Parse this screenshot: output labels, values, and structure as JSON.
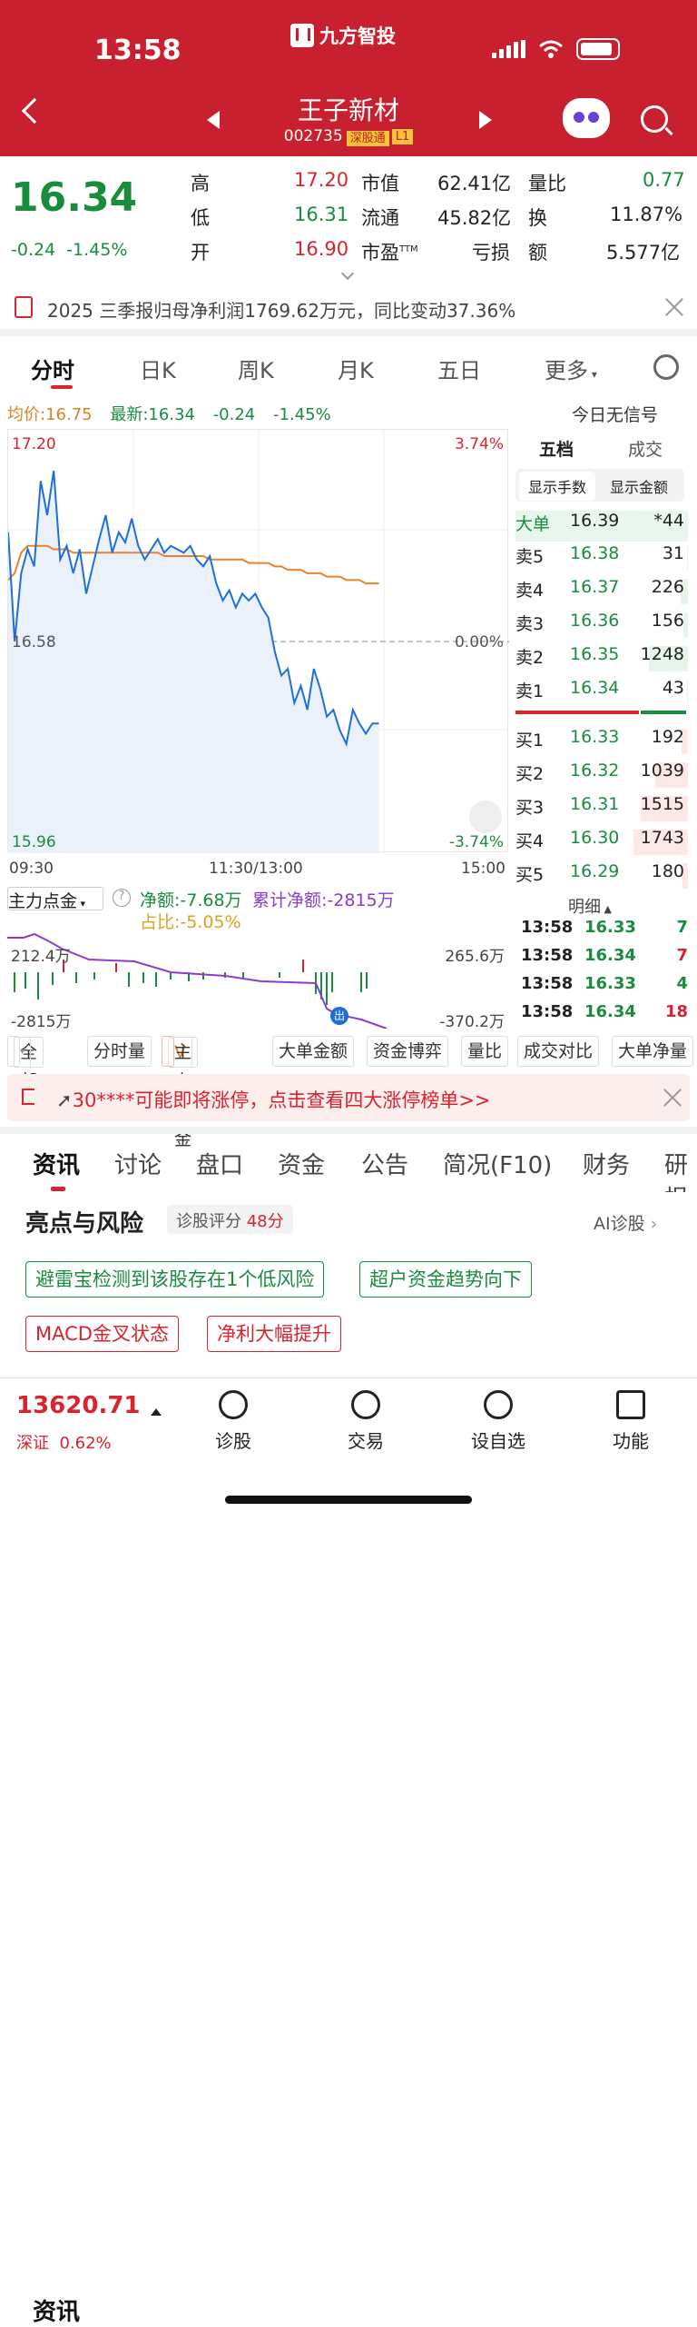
{
  "status": {
    "time": "13:58",
    "app_name": "九方智投"
  },
  "stock": {
    "name": "王子新材",
    "code": "002735",
    "tag1": "深股通",
    "tag2": "L1"
  },
  "quote": {
    "price": "16.34",
    "change": "-0.24",
    "change_pct": "-1.45%",
    "high_label": "高",
    "high": "17.20",
    "low_label": "低",
    "low": "16.31",
    "open_label": "开",
    "open": "16.90",
    "mcap_label": "市值",
    "mcap": "62.41亿",
    "float_label": "流通",
    "float": "45.82亿",
    "pe_label": "市盈",
    "pe_sup": "TTM",
    "pe": "亏损",
    "vr_label": "量比",
    "vr": "0.77",
    "turn_label": "换",
    "turn": "11.87%",
    "amt_label": "额",
    "amt": "5.577亿"
  },
  "notice": "2025 三季报归母净利润1769.62万元，同比变动37.36%",
  "chart_tabs": [
    "分时",
    "日K",
    "周K",
    "月K",
    "五日",
    "更多"
  ],
  "avg_line": {
    "avg": "均价:16.75",
    "latest": "最新:16.34",
    "chg": "-0.24",
    "pct": "-1.45%"
  },
  "no_signal": "今日无信号",
  "chart_data": {
    "type": "line",
    "x_ticks": [
      "09:30",
      "11:30/13:00",
      "15:00"
    ],
    "y_left": [
      "17.20",
      "16.58",
      "15.96"
    ],
    "y_right": [
      "3.74%",
      "0.00%",
      "-3.74%"
    ],
    "prev_close": 16.58,
    "ylim": [
      15.96,
      17.2
    ],
    "series": [
      {
        "values": [
          16.9,
          16.58,
          16.78,
          16.85,
          16.8,
          17.05,
          16.95,
          17.08,
          16.82,
          16.86,
          16.78,
          16.85,
          16.72,
          16.8,
          16.88,
          16.95,
          16.84,
          16.9,
          16.87,
          16.94,
          16.86,
          16.82,
          16.85,
          16.88,
          16.84,
          16.86,
          16.85,
          16.84,
          16.86,
          16.82,
          16.8,
          16.83,
          16.75,
          16.7,
          16.73,
          16.68,
          16.72,
          16.7,
          16.72,
          16.68,
          16.65,
          16.55,
          16.48,
          16.5,
          16.4,
          16.45,
          16.38,
          16.5,
          16.44,
          16.36,
          16.38,
          16.32,
          16.28,
          16.38,
          16.34,
          16.31,
          16.34,
          16.34
        ]
      },
      {
        "values": [
          16.76,
          16.78,
          16.84,
          16.86,
          16.86,
          16.86,
          16.86,
          16.85,
          16.85,
          16.85,
          16.84,
          16.84,
          16.84,
          16.84,
          16.84,
          16.84,
          16.84,
          16.84,
          16.84,
          16.84,
          16.84,
          16.84,
          16.84,
          16.84,
          16.83,
          16.83,
          16.83,
          16.83,
          16.83,
          16.83,
          16.83,
          16.82,
          16.82,
          16.82,
          16.82,
          16.82,
          16.82,
          16.81,
          16.81,
          16.81,
          16.81,
          16.8,
          16.8,
          16.79,
          16.79,
          16.79,
          16.78,
          16.78,
          16.78,
          16.77,
          16.77,
          16.77,
          16.76,
          16.76,
          16.76,
          16.75,
          16.75,
          16.75
        ]
      }
    ]
  },
  "orderbook": {
    "tabs": [
      "五档",
      "成交"
    ],
    "buttons": [
      "显示手数",
      "显示金额"
    ],
    "big": {
      "label": "大单",
      "price": "16.39",
      "vol": "*44"
    },
    "asks": [
      {
        "label": "卖5",
        "price": "16.38",
        "vol": "31"
      },
      {
        "label": "卖4",
        "price": "16.37",
        "vol": "226"
      },
      {
        "label": "卖3",
        "price": "16.36",
        "vol": "156"
      },
      {
        "label": "卖2",
        "price": "16.35",
        "vol": "1248"
      },
      {
        "label": "卖1",
        "price": "16.34",
        "vol": "43"
      }
    ],
    "bids": [
      {
        "label": "买1",
        "price": "16.33",
        "vol": "192"
      },
      {
        "label": "买2",
        "price": "16.32",
        "vol": "1039"
      },
      {
        "label": "买3",
        "price": "16.31",
        "vol": "1515"
      },
      {
        "label": "买4",
        "price": "16.30",
        "vol": "1743"
      },
      {
        "label": "买5",
        "price": "16.29",
        "vol": "180"
      }
    ],
    "detail_label": "明细",
    "trades": [
      {
        "t": "13:58",
        "p": "16.33",
        "v": "7"
      },
      {
        "t": "13:58",
        "p": "16.34",
        "v": "7"
      },
      {
        "t": "13:58",
        "p": "16.33",
        "v": "4"
      },
      {
        "t": "13:58",
        "p": "16.34",
        "v": "18"
      }
    ]
  },
  "flow": {
    "select": "主力点金",
    "net": "净额:-7.68万",
    "cum": "累计净额:-2815万",
    "ratio": "占比:-5.05%",
    "y1": "212.4万",
    "y2": "-2815万",
    "y3": "265.6万",
    "y4": "-370.2万",
    "marker": "出"
  },
  "indicators": [
    "全部",
    "分时量",
    "主力点金",
    "大单金额",
    "资金博弈",
    "量比",
    "成交对比",
    "大单净量"
  ],
  "promo": "30****可能即将涨停，点击查看四大涨停榜单>>",
  "news_tabs": [
    "资讯",
    "讨论",
    "盘口",
    "资金",
    "公告",
    "简况(F10)",
    "财务",
    "研报"
  ],
  "highlights": {
    "title": "亮点与风险",
    "score_label": "诊股评分",
    "score": "48分",
    "ai": "AI诊股",
    "tags": [
      "避雷宝检测到该股存在1个低风险",
      "超户资金趋势向下",
      "MACD金叉状态",
      "净利大幅提升"
    ]
  },
  "bottom": {
    "index_value": "13620.71",
    "index_name": "深证",
    "index_pct": "0.62%",
    "nav": [
      "诊股",
      "交易",
      "设自选",
      "功能"
    ]
  }
}
